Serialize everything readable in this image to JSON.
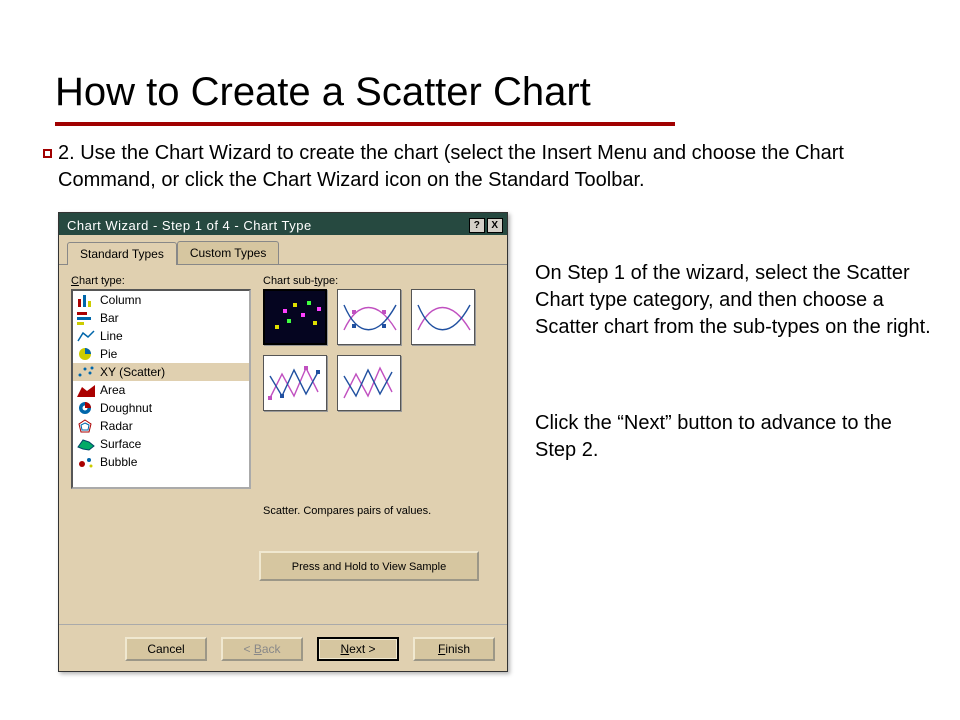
{
  "slide": {
    "title": "How to Create a Scatter Chart",
    "bullet_text": "2.  Use the Chart Wizard to create the chart (select the Insert Menu and choose the Chart Command, or click the Chart Wizard icon on the Standard Toolbar.",
    "side1": "On Step 1 of the wizard, select the Scatter Chart type category, and then choose a Scatter chart from the sub-types on the right.",
    "side2": "Click the “Next” button to advance to the Step 2."
  },
  "dialog": {
    "title": "Chart Wizard - Step 1 of 4 - Chart Type",
    "help_label": "?",
    "close_label": "X",
    "tabs": {
      "standard": "Standard Types",
      "custom": "Custom Types",
      "active": "standard"
    },
    "chart_type_label": "Chart type:",
    "chart_subtype_label": "Chart sub-type:",
    "types": [
      {
        "name": "Column",
        "icon": "column"
      },
      {
        "name": "Bar",
        "icon": "bar"
      },
      {
        "name": "Line",
        "icon": "line"
      },
      {
        "name": "Pie",
        "icon": "pie"
      },
      {
        "name": "XY (Scatter)",
        "icon": "scatter",
        "selected": true
      },
      {
        "name": "Area",
        "icon": "area"
      },
      {
        "name": "Doughnut",
        "icon": "doughnut"
      },
      {
        "name": "Radar",
        "icon": "radar"
      },
      {
        "name": "Surface",
        "icon": "surface"
      },
      {
        "name": "Bubble",
        "icon": "bubble"
      }
    ],
    "subtypes_count": 5,
    "subtype_selected": 0,
    "description": "Scatter. Compares pairs of values.",
    "sample_button": "Press and Hold to View Sample",
    "buttons": {
      "cancel": "Cancel",
      "back": "< Back",
      "next": "Next >",
      "finish": "Finish"
    }
  }
}
